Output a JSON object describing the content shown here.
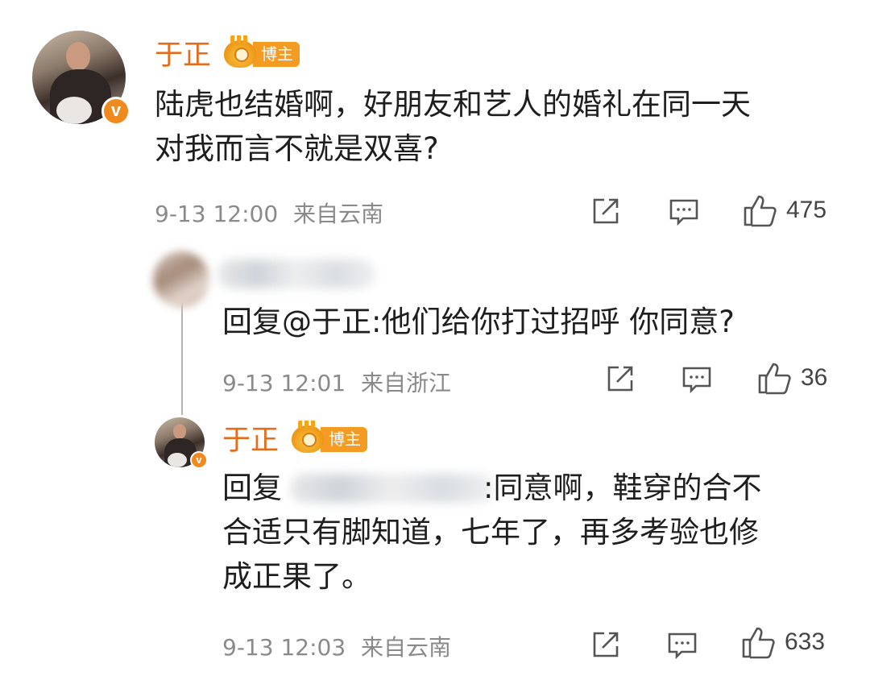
{
  "comments": [
    {
      "username": "于正",
      "badge_label": "博主",
      "verified_mark": "v",
      "text_lines": [
        "陆虎也结婚啊，好朋友和艺人的婚礼在同一天",
        "对我而言不就是双喜?"
      ],
      "time": "9-13 12:00",
      "location": "来自云南",
      "likes": "475"
    },
    {
      "reply_prefix": "回复",
      "mention": "@于正",
      "text": ":他们给你打过招呼 你同意?",
      "time": "9-13 12:01",
      "location": "来自浙江",
      "likes": "36"
    },
    {
      "username": "于正",
      "badge_label": "博主",
      "verified_mark": "v",
      "reply_prefix": "回复",
      "text_first": ":同意啊，鞋穿的合不",
      "text_lines": [
        "合适只有脚知道，七年了，再多考验也修",
        "成正果了。"
      ],
      "time": "9-13 12:03",
      "location": "来自云南",
      "likes": "633"
    }
  ],
  "icons": [
    "share-icon",
    "comment-icon",
    "like-icon"
  ],
  "colors": {
    "username": "#e56c1b",
    "badge": "#f39b22",
    "meta": "#8a8a8a"
  }
}
